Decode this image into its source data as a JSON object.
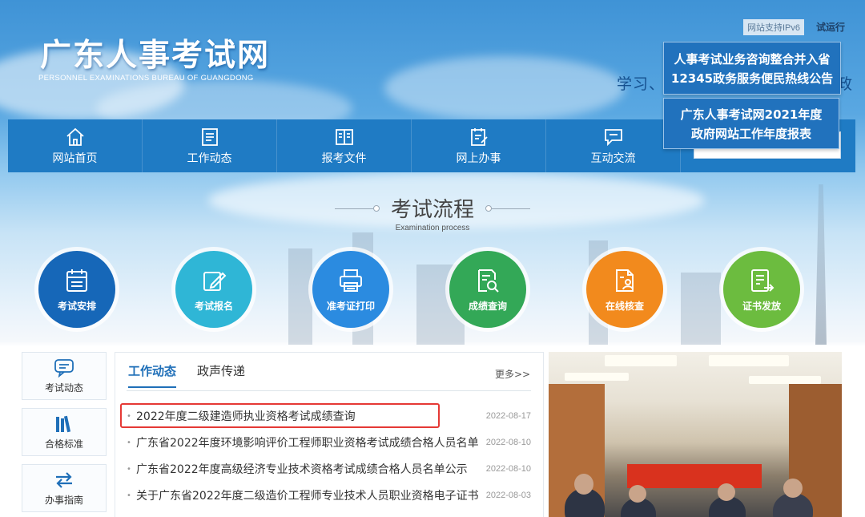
{
  "header": {
    "site_title": "广东人事考试网",
    "site_subtitle": "PERSONNEL EXAMINATIONS BUREAU OF GUANGDONG",
    "ipv6_badge": "网站支持IPv6",
    "trial_label": "试运行",
    "slogan": "学习、",
    "slogan_tail": "政"
  },
  "notices": [
    {
      "line1": "人事考试业务咨询整合并入省",
      "line2": "12345政务服务便民热线公告"
    },
    {
      "line1": "广东人事考试网2021年度",
      "line2": "政府网站工作年度报表"
    }
  ],
  "nav": {
    "items": [
      {
        "label": "网站首页",
        "icon": "home-icon"
      },
      {
        "label": "工作动态",
        "icon": "list-icon"
      },
      {
        "label": "报考文件",
        "icon": "book-icon"
      },
      {
        "label": "网上办事",
        "icon": "edit-doc-icon"
      },
      {
        "label": "互动交流",
        "icon": "chat-icon"
      }
    ],
    "search_placeholder": ""
  },
  "process": {
    "title": "考试流程",
    "subtitle": "Examination process",
    "steps": [
      {
        "label": "考试安排",
        "color": "#1667b8",
        "icon": "calendar-icon"
      },
      {
        "label": "考试报名",
        "color": "#2fb6d6",
        "icon": "pen-icon"
      },
      {
        "label": "准考证打印",
        "color": "#2b8be0",
        "icon": "printer-icon"
      },
      {
        "label": "成绩查询",
        "color": "#33a857",
        "icon": "search-doc-icon"
      },
      {
        "label": "在线核查",
        "color": "#f28a1d",
        "icon": "user-doc-icon"
      },
      {
        "label": "证书发放",
        "color": "#6cbc3f",
        "icon": "certificate-icon"
      }
    ]
  },
  "sidebar": {
    "items": [
      {
        "label": "考试动态",
        "icon": "message-icon"
      },
      {
        "label": "合格标准",
        "icon": "books-icon"
      },
      {
        "label": "办事指南",
        "icon": "swap-icon"
      }
    ]
  },
  "news": {
    "tabs": [
      {
        "label": "工作动态"
      },
      {
        "label": "政声传递"
      }
    ],
    "more": "更多>>",
    "items": [
      {
        "title": "2022年度二级建造师执业资格考试成绩查询",
        "date": "2022-08-17"
      },
      {
        "title": "广东省2022年度环境影响评价工程师职业资格考试成绩合格人员名单",
        "date": "2022-08-10"
      },
      {
        "title": "广东省2022年度高级经济专业技术资格考试成绩合格人员名单公示",
        "date": "2022-08-10"
      },
      {
        "title": "关于广东省2022年度二级造价工程师专业技术人员职业资格电子证书",
        "date": "2022-08-03"
      }
    ]
  },
  "colors": {
    "nav_bg": "#1f7bc4",
    "notice_bg": "#2172bd",
    "accent": "#1f6fb8",
    "highlight": "#e53935"
  }
}
